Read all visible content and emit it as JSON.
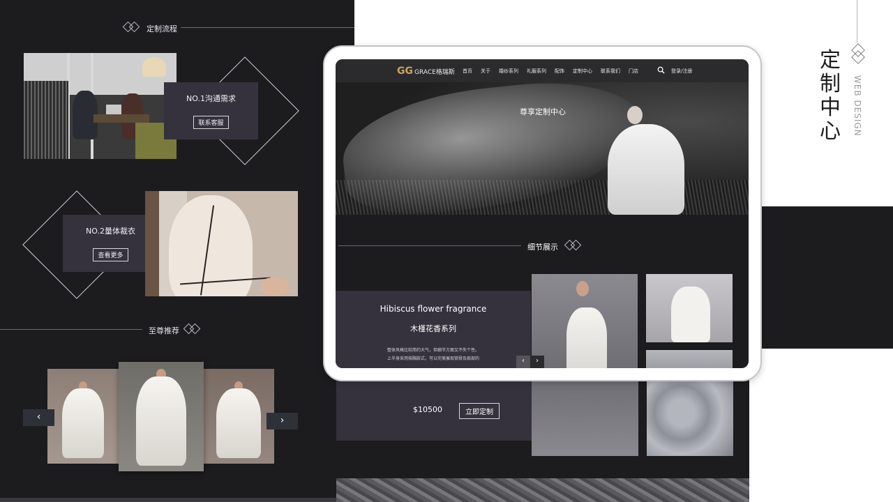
{
  "left_panel": {
    "section1_title": "定制流程",
    "step1": {
      "title": "NO.1沟通需求",
      "button": "联系客服"
    },
    "step2": {
      "title": "NO.2量体裁衣",
      "button": "查看更多"
    },
    "section2_title": "至尊推荐",
    "carousel_prev": "‹",
    "carousel_next": "›"
  },
  "tablet_site": {
    "logo_text": "GRACE格瑞斯",
    "nav_items": [
      "首页",
      "关于",
      "婚纱系列",
      "礼服系列",
      "配饰",
      "定制中心",
      "联系我们",
      "门店"
    ],
    "login": "登录/注册",
    "hero_title": "尊享定制中心",
    "detail_section_title": "细节展示",
    "promo": {
      "title_en": "Hibiscus flower fragrance",
      "title_cn": "木槿花香系列",
      "desc_line1": "整体风格比较简约大气，但细节方面又不失个性。",
      "desc_line2": "上半身采用抹胸款式，可以完美展现锁骨及肩部的"
    },
    "price": "$10500",
    "cta_button": "立即定制",
    "arrow_prev": "‹",
    "arrow_next": "›"
  },
  "right_label": {
    "title": "定制中心",
    "subtitle": "WEB DESIGN"
  },
  "colors": {
    "dark_bg": "#1c1b1e",
    "card_bg": "#36323d",
    "accent_gold": "#c9a45c"
  },
  "icons": [
    "diamond-pair-icon",
    "search-icon",
    "chevron-left-icon",
    "chevron-right-icon",
    "logo-mark-icon"
  ]
}
